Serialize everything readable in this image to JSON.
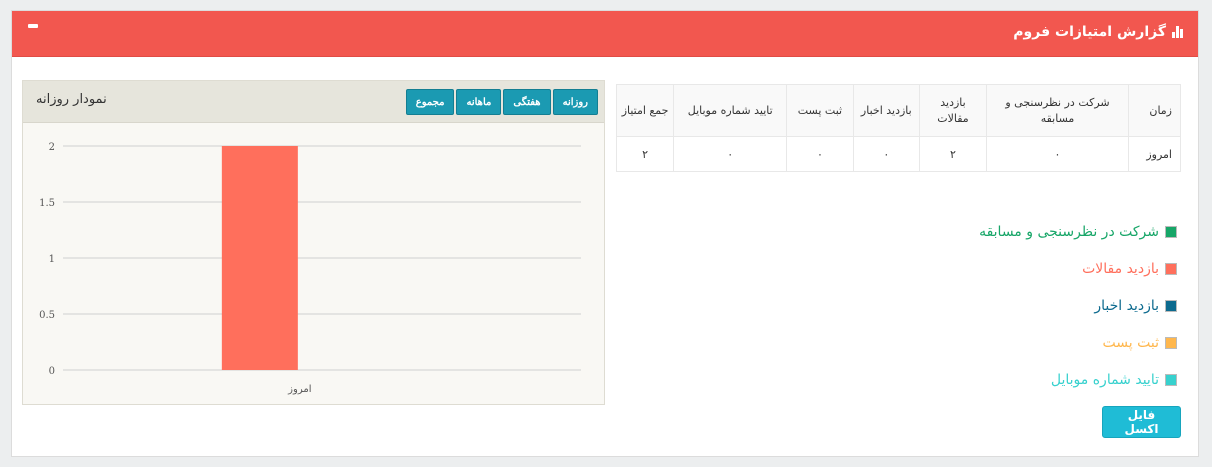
{
  "panel": {
    "title": "گزارش امتیازات فروم"
  },
  "chart_box": {
    "title": "نمودار روزانه",
    "tabs": [
      "روزانه",
      "هفتگی",
      "ماهانه",
      "مجموع"
    ]
  },
  "chart_data": {
    "type": "bar",
    "categories": [
      "امروز"
    ],
    "values": [
      2
    ],
    "ylim": [
      0,
      2
    ],
    "yticks": [
      "0",
      "0.5",
      "1",
      "1.5",
      "2"
    ],
    "bar_color": "#ff6f5c",
    "grid": true
  },
  "table": {
    "headers": [
      "زمان",
      "شرکت در نظرسنجی و مسابقه",
      "بازدید مقالات",
      "بازدید اخبار",
      "ثبت پست",
      "تایید شماره موبایل",
      "جمع امتیاز"
    ],
    "rows": [
      [
        "امروز",
        "۰",
        "۲",
        "۰",
        "۰",
        "۰",
        "۲"
      ]
    ]
  },
  "legend": [
    {
      "label": "شرکت در نظرسنجی و مسابقه",
      "color": "#17a668"
    },
    {
      "label": "بازدید مقالات",
      "color": "#ff6f5c"
    },
    {
      "label": "بازدید اخبار",
      "color": "#0c6a8e"
    },
    {
      "label": "ثبت پست",
      "color": "#ffb74d"
    },
    {
      "label": "تایید شماره موبایل",
      "color": "#37d1ce"
    }
  ],
  "excel_button": {
    "label": "فایل اکسل"
  }
}
